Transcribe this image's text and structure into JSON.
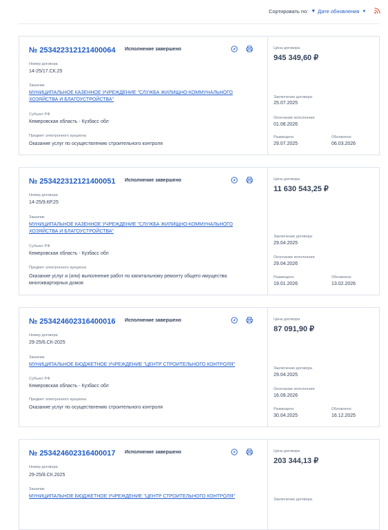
{
  "sort": {
    "label": "Сортировать по:",
    "value": "Дате обновления"
  },
  "labels": {
    "contract_number": "Номер договора",
    "customer": "Заказчик",
    "subject": "Субъект РФ",
    "auction": "Предмет электронного аукциона",
    "price": "Цена договора",
    "concluded": "Заключение договора",
    "ends": "Окончание исполнения",
    "placed": "Размещено",
    "updated": "Обновлено"
  },
  "cards": [
    {
      "number": "№ 253422312121400064",
      "status": "Исполнение завершено",
      "contract_number": "14-25/17.СК.25",
      "customer": "МУНИЦИПАЛЬНОЕ КАЗЕННОЕ УЧРЕЖДЕНИЕ \"СЛУЖБА ЖИЛИЩНО-КОММУНАЛЬНОГО ХОЗЯЙСТВА И БЛАГОУСТРОЙСТВА\"",
      "subject": "Кемеровская область - Кузбасс обл",
      "auction": "Оказание услуг по осуществлению строительного контроля",
      "price": "945 349,60 ₽",
      "concluded": "25.07.2025",
      "ends": "01.08.2026",
      "placed": "29.07.2025",
      "updated": "06.03.2026"
    },
    {
      "number": "№ 253422312121400051",
      "status": "Исполнение завершено",
      "contract_number": "14-25/9.КР.25",
      "customer": "МУНИЦИПАЛЬНОЕ КАЗЕННОЕ УЧРЕЖДЕНИЕ \"СЛУЖБА ЖИЛИЩНО-КОММУНАЛЬНОГО ХОЗЯЙСТВА И БЛАГОУСТРОЙСТВА\"",
      "subject": "Кемеровская область - Кузбасс обл",
      "auction": "Оказание услуг и (или) выполнение работ по капитальному ремонту общего имущества многоквартирных домов",
      "price": "11 630 543,25 ₽",
      "concluded": "29.04.2025",
      "ends": "29.04.2026",
      "placed": "19.01.2026",
      "updated": "13.02.2026"
    },
    {
      "number": "№ 253424602316400016",
      "status": "Исполнение завершено",
      "contract_number": "29-25/6.СК-2025",
      "customer": "МУНИЦИПАЛЬНОЕ БЮДЖЕТНОЕ УЧРЕЖДЕНИЕ \"ЦЕНТР СТРОИТЕЛЬНОГО КОНТРОЛЯ\"",
      "subject": "Кемеровская область - Кузбасс обл",
      "auction": "Оказание услуг по осуществлению строительного контроля",
      "price": "87 091,90 ₽",
      "concluded": "29.04.2025",
      "ends": "16.09.2026",
      "placed": "30.04.2025",
      "updated": "16.12.2025"
    },
    {
      "number": "№ 253424602316400017",
      "status": "Исполнение завершено",
      "contract_number": "29-25/8.СК.2025",
      "customer": "МУНИЦИПАЛЬНОЕ БЮДЖЕТНОЕ УЧРЕЖДЕНИЕ \"ЦЕНТР СТРОИТЕЛЬНОГО КОНТРОЛЯ\"",
      "price": "203 344,13 ₽"
    }
  ]
}
